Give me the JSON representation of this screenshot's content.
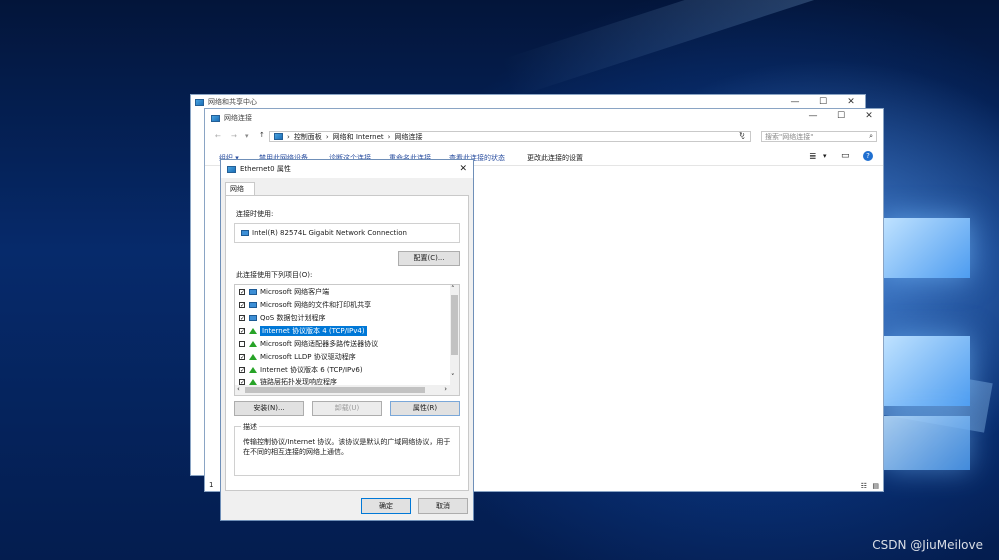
{
  "back_window": {
    "title": "网络和共享中心",
    "controls": [
      "—",
      "☐",
      "✕"
    ]
  },
  "front_window": {
    "title": "网络连接",
    "controls": [
      "—",
      "☐",
      "✕"
    ],
    "nav": {
      "back": "←",
      "forward": "→",
      "recent": "▾",
      "up": "↑"
    },
    "breadcrumb": [
      "控制面板",
      "网络和 Internet",
      "网络连接"
    ],
    "breadcrumb_sep": "›",
    "address_dropdown": "⌄",
    "refresh": "↻",
    "search_placeholder": "搜索\"网络连接\"",
    "search_icon": "⌕",
    "commands": [
      "组织 ▾",
      "禁用此网络设备",
      "诊断这个连接",
      "重命名此连接",
      "查看此连接的状态",
      "更改此连接的设置"
    ],
    "view_icons": [
      "≣",
      "▾",
      "▭"
    ],
    "help": "?",
    "status_left": "1",
    "status_right": [
      "☷",
      "▤"
    ]
  },
  "dialog": {
    "title": "Ethernet0 属性",
    "close": "✕",
    "tab": "网络",
    "connect_using_label": "连接时使用:",
    "adapter": "Intel(R) 82574L Gigabit Network Connection",
    "configure_button": "配置(C)...",
    "items_label": "此连接使用下列项目(O):",
    "items": [
      {
        "checked": true,
        "icon": "network-client-icon",
        "label": "Microsoft 网络客户端"
      },
      {
        "checked": true,
        "icon": "network-client-icon",
        "label": "Microsoft 网络的文件和打印机共享"
      },
      {
        "checked": true,
        "icon": "network-client-icon",
        "label": "QoS 数据包计划程序"
      },
      {
        "checked": true,
        "icon": "protocol-icon",
        "label": "Internet 协议版本 4 (TCP/IPv4)",
        "selected": true
      },
      {
        "checked": false,
        "icon": "protocol-icon",
        "label": "Microsoft 网络适配器多路传送器协议"
      },
      {
        "checked": true,
        "icon": "protocol-icon",
        "label": "Microsoft LLDP 协议驱动程序"
      },
      {
        "checked": true,
        "icon": "protocol-icon",
        "label": "Internet 协议版本 6 (TCP/IPv6)"
      },
      {
        "checked": true,
        "icon": "protocol-icon",
        "label": "链路层拓扑发现响应程序"
      }
    ],
    "check_mark": "✓",
    "scroll_up": "˄",
    "scroll_down": "˅",
    "scroll_left": "‹",
    "scroll_right": "›",
    "install_button": "安装(N)...",
    "uninstall_button": "卸载(U)",
    "properties_button": "属性(R)",
    "description_label": "描述",
    "description_text": "传输控制协议/Internet 协议。该协议是默认的广域网络协议，用于在不同的相互连接的网络上通信。",
    "ok_button": "确定",
    "cancel_button": "取消"
  },
  "watermark": "CSDN @JiuMeilove"
}
